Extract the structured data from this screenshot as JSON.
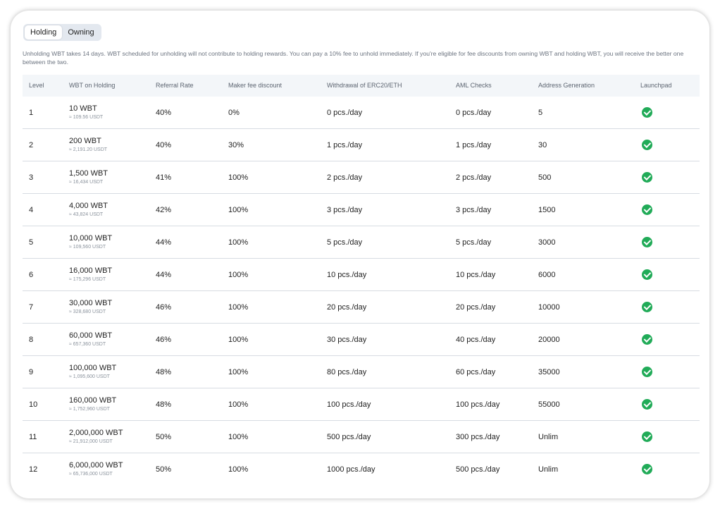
{
  "tabs": [
    {
      "label": "Holding",
      "active": true
    },
    {
      "label": "Owning",
      "active": false
    }
  ],
  "notice": "Unholding WBT takes 14 days. WBT scheduled for unholding will not contribute to holding rewards. You can pay a 10% fee to unhold immediately. If you're eligible for fee discounts from owning WBT and holding WBT, you will receive the better one between the two.",
  "table": {
    "headers": [
      "Level",
      "WBT on Holding",
      "Referral Rate",
      "Maker fee discount",
      "Withdrawal of ERC20/ETH",
      "AML Checks",
      "Address Generation",
      "Launchpad"
    ],
    "rows": [
      {
        "level": "1",
        "wbt": "10 WBT",
        "usdt": "≈ 109.56 USDT",
        "referral": "40%",
        "maker": "0%",
        "withdrawal": "0 pcs./day",
        "aml": "0 pcs./day",
        "address": "5",
        "launchpad": "check-icon"
      },
      {
        "level": "2",
        "wbt": "200 WBT",
        "usdt": "≈ 2,191.20 USDT",
        "referral": "40%",
        "maker": "30%",
        "withdrawal": "1 pcs./day",
        "aml": "1 pcs./day",
        "address": "30",
        "launchpad": "check-icon"
      },
      {
        "level": "3",
        "wbt": "1,500 WBT",
        "usdt": "≈ 16,434 USDT",
        "referral": "41%",
        "maker": "100%",
        "withdrawal": "2 pcs./day",
        "aml": "2 pcs./day",
        "address": "500",
        "launchpad": "check-icon"
      },
      {
        "level": "4",
        "wbt": "4,000 WBT",
        "usdt": "≈ 43,824 USDT",
        "referral": "42%",
        "maker": "100%",
        "withdrawal": "3 pcs./day",
        "aml": "3 pcs./day",
        "address": "1500",
        "launchpad": "check-icon"
      },
      {
        "level": "5",
        "wbt": "10,000 WBT",
        "usdt": "≈ 109,560 USDT",
        "referral": "44%",
        "maker": "100%",
        "withdrawal": "5 pcs./day",
        "aml": "5 pcs./day",
        "address": "3000",
        "launchpad": "check-icon"
      },
      {
        "level": "6",
        "wbt": "16,000 WBT",
        "usdt": "≈ 175,296 USDT",
        "referral": "44%",
        "maker": "100%",
        "withdrawal": "10 pcs./day",
        "aml": "10 pcs./day",
        "address": "6000",
        "launchpad": "check-icon"
      },
      {
        "level": "7",
        "wbt": "30,000 WBT",
        "usdt": "≈ 328,680 USDT",
        "referral": "46%",
        "maker": "100%",
        "withdrawal": "20 pcs./day",
        "aml": "20 pcs./day",
        "address": "10000",
        "launchpad": "check-icon"
      },
      {
        "level": "8",
        "wbt": "60,000 WBT",
        "usdt": "≈ 657,360 USDT",
        "referral": "46%",
        "maker": "100%",
        "withdrawal": "30 pcs./day",
        "aml": "40 pcs./day",
        "address": "20000",
        "launchpad": "check-icon"
      },
      {
        "level": "9",
        "wbt": "100,000 WBT",
        "usdt": "≈ 1,095,600 USDT",
        "referral": "48%",
        "maker": "100%",
        "withdrawal": "80 pcs./day",
        "aml": "60 pcs./day",
        "address": "35000",
        "launchpad": "check-icon"
      },
      {
        "level": "10",
        "wbt": "160,000 WBT",
        "usdt": "≈ 1,752,960 USDT",
        "referral": "48%",
        "maker": "100%",
        "withdrawal": "100 pcs./day",
        "aml": "100 pcs./day",
        "address": "55000",
        "launchpad": "check-icon"
      },
      {
        "level": "11",
        "wbt": "2,000,000 WBT",
        "usdt": "≈ 21,912,000 USDT",
        "referral": "50%",
        "maker": "100%",
        "withdrawal": "500 pcs./day",
        "aml": "300 pcs./day",
        "address": "Unlim",
        "launchpad": "check-icon"
      },
      {
        "level": "12",
        "wbt": "6,000,000 WBT",
        "usdt": "≈ 65,736,000 USDT",
        "referral": "50%",
        "maker": "100%",
        "withdrawal": "1000 pcs./day",
        "aml": "500 pcs./day",
        "address": "Unlim",
        "launchpad": "check-icon"
      }
    ]
  },
  "colors": {
    "check": "#21ab58",
    "header_bg": "#f3f6f9",
    "tab_bg": "#e3e8ef",
    "divider": "#d7dce2"
  }
}
